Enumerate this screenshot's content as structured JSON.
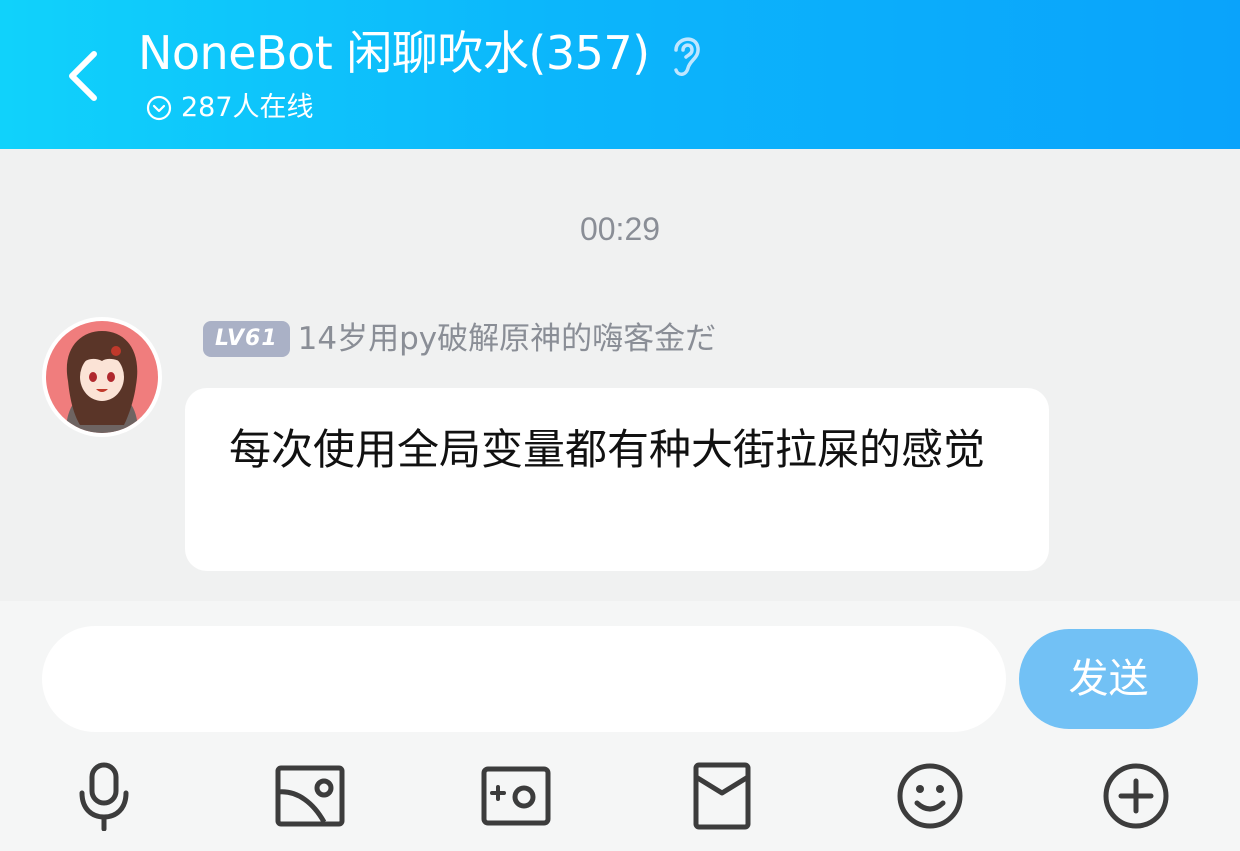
{
  "header": {
    "title": "NoneBot 闲聊吹水(357)",
    "online": "287人在线",
    "back_icon": "chevron-left-icon",
    "listen_icon": "ear-icon"
  },
  "chat": {
    "timestamp": "00:29",
    "messages": [
      {
        "level": "LV61",
        "nickname": "14岁用py破解原神的嗨客金だ",
        "text": "每次使用全局变量都有种大街拉屎的感觉"
      }
    ]
  },
  "input": {
    "value": "",
    "send_label": "发送"
  },
  "toolbar": {
    "items": [
      "microphone-icon",
      "image-icon",
      "camera-icon",
      "red-packet-icon",
      "emoji-icon",
      "plus-icon"
    ]
  },
  "colors": {
    "header_gradient_start": "#10d2fb",
    "header_gradient_end": "#0aa3fb",
    "send_button": "#72c1f5",
    "level_badge": "#aab1c6"
  }
}
